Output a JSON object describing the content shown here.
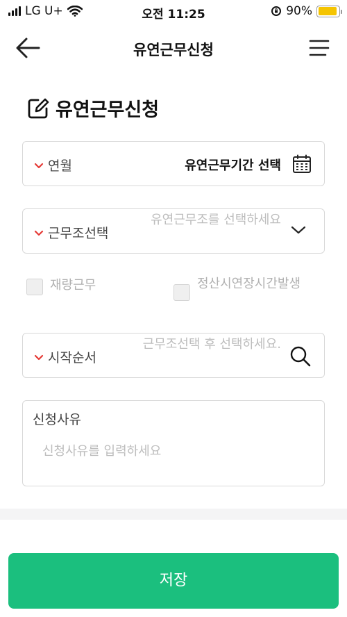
{
  "status_bar": {
    "carrier": "LG U+",
    "time": "오전 11:25",
    "battery_percent": "90%",
    "battery_level": 0.9,
    "battery_color": "#f5c400"
  },
  "header": {
    "title": "유연근무신청",
    "back_icon": "arrow-left-icon",
    "menu_icon": "hamburger-menu-icon"
  },
  "section": {
    "title": "유연근무신청",
    "icon": "edit-icon"
  },
  "fields": {
    "period": {
      "label": "연월",
      "value": "유연근무기간 선택",
      "icon": "calendar-icon"
    },
    "work_type": {
      "label": "근무조선택",
      "placeholder": "유연근무조를 선택하세요",
      "icon": "chevron-down-icon"
    },
    "discretionary": {
      "label": "재량근무"
    },
    "overtime": {
      "label": "정산시연장시간발생"
    },
    "start_order": {
      "label": "시작순서",
      "placeholder": "근무조선택 후 선택하세요.",
      "icon": "search-icon"
    },
    "reason": {
      "label": "신청사유",
      "placeholder": "신청사유를 입력하세요"
    }
  },
  "save_button": {
    "label": "저장",
    "color": "#1bbf7e"
  },
  "required_mark_color": "#e53935"
}
